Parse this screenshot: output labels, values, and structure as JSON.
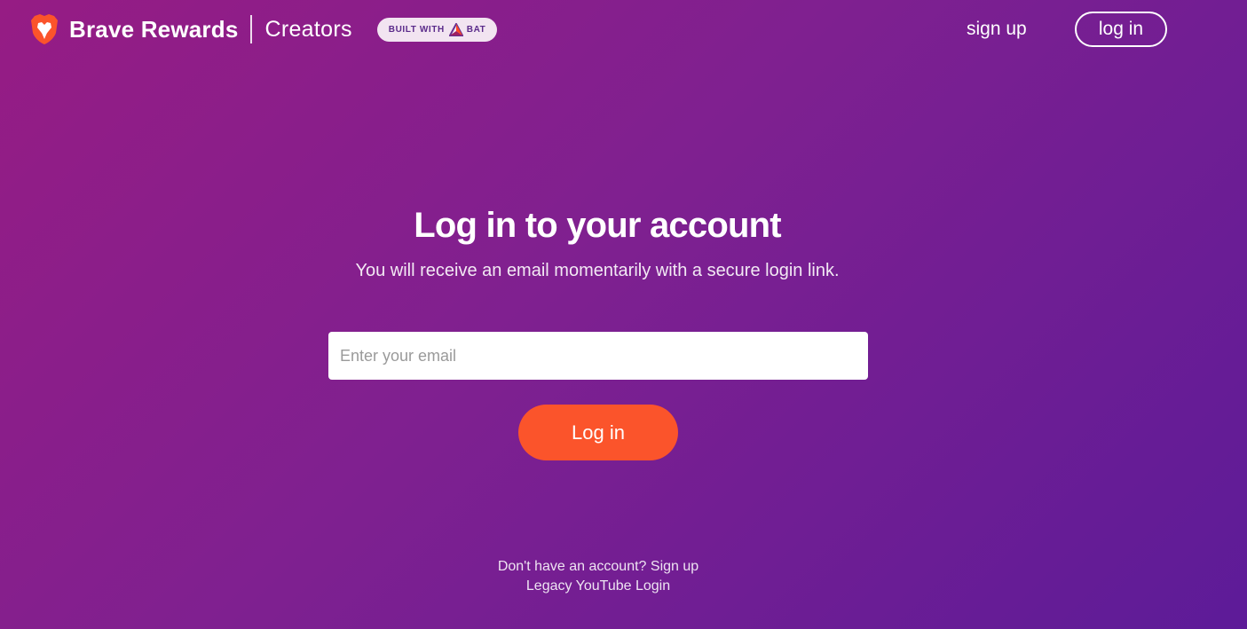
{
  "header": {
    "brand_name": "Brave Rewards",
    "brand_sub": "Creators",
    "badge_prefix": "BUILT WITH",
    "badge_suffix": "BAT",
    "signup_label": "sign up",
    "login_label": "log in"
  },
  "main": {
    "title": "Log in to your account",
    "subtitle": "You will receive an email momentarily with a secure login link.",
    "email_placeholder": "Enter your email",
    "email_value": "",
    "login_button_label": "Log in"
  },
  "footer": {
    "no_account_text": "Don't have an account?",
    "signup_link": "Sign up",
    "legacy_link": "Legacy YouTube Login"
  },
  "colors": {
    "background_start": "#961c84",
    "background_end": "#5d1b98",
    "accent_orange": "#fb542b",
    "badge_bg": "#f2e4f1"
  },
  "icons": {
    "logo": "brave-lion-icon",
    "badge": "bat-triangle-icon"
  }
}
